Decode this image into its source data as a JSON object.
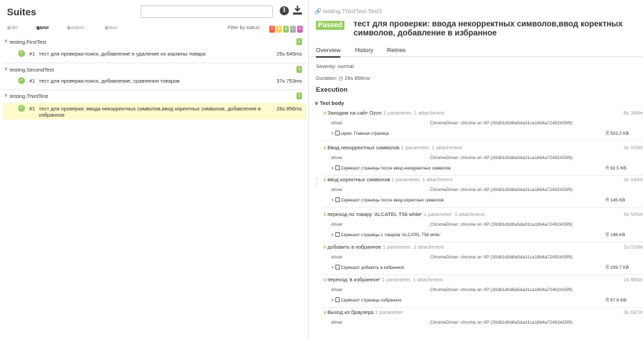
{
  "colors": {
    "passed": "#97cc64",
    "failed": "#fd5a3e",
    "broken": "#ffd050",
    "skipped": "#aaaaaa",
    "unknown": "#d35ebe",
    "selected_row": "#fdfacc"
  },
  "left": {
    "title": "Suites",
    "search_placeholder": "",
    "sort": {
      "order": "order",
      "name": "name",
      "duration": "duration",
      "status": "status"
    },
    "filter_label": "Filter by status:",
    "status_counts": [
      "0",
      "0",
      "3",
      "0",
      "0"
    ],
    "groups": [
      {
        "name": "testing.FirstTest",
        "count": "1",
        "tests": [
          {
            "num": "#1",
            "name": "тест для проверки:поиск, добавление и удаление из корзины товара",
            "duration": "25s 645ms"
          }
        ]
      },
      {
        "name": "testing.SecondTest",
        "count": "1",
        "tests": [
          {
            "num": "#1",
            "name": "тест для проверки:поиск, добавление, сравнения товаров",
            "duration": "37s 753ms"
          }
        ]
      },
      {
        "name": "testing.ThirdTest",
        "count": "1",
        "tests": [
          {
            "num": "#1",
            "name": "тест для проверки: ввода некорректных символов,ввод коректных символов, добавление в избранное",
            "duration": "26s 856ms"
          }
        ]
      }
    ]
  },
  "right": {
    "breadcrumb": "testing.ThirdTest.Test3",
    "status": "Passed",
    "title": "тест для проверки: ввода некорректных символов,ввод коректных символов, добавление в избранное",
    "tabs": [
      "Overview",
      "History",
      "Retries"
    ],
    "severity": "Severity: normal",
    "duration": "Duration: ◷ 26s 856ms",
    "execution": "Execution",
    "test_body": "Test body",
    "steps": [
      {
        "name": "Заходим на сайт Ozon",
        "extra": "1 parameter, 1 attachment",
        "time": "8s 368m",
        "param": "driver",
        "value": "ChromeDriver: chrome on XP (30d81d0d8a5da31ca18b4a72492435f9)",
        "attachment": "скрин: Главная страница",
        "size": "503.2 KB"
      },
      {
        "name": "Ввод некорректных символов",
        "extra": "1 parameter, 1 attachment",
        "time": "3s 109m",
        "param": "driver",
        "value": "ChromeDriver: chrome on XP (30d81d0d8a5da31ca18b4a72492435f9)",
        "attachment": "Скриншот страницы после ввод некорректных символов",
        "size": "92.5 KB"
      },
      {
        "name": "ввод коректных символов",
        "extra": "1 parameter, 1 attachment",
        "time": "3s 140m",
        "param": "driver",
        "value": "ChromeDriver: chrome on XP (30d81d0d8a5da31ca18b4a72492435f9)",
        "attachment": "Скриншот страницы после ввод коректных символов",
        "size": "145 KB"
      },
      {
        "name": "переход по товару 'ALCATEL T56 white'",
        "extra": "1 parameter, 1 attachment",
        "time": "3s 545m",
        "param": "driver",
        "value": "ChromeDriver: chrome on XP (30d81d0d8a5da31ca18b4a72492435f9)",
        "attachment": "Скриншот страницы с товаром 'ALCATEL T56 white'",
        "size": "196 KB"
      },
      {
        "name": "добавить в избранное",
        "extra": "1 parameter, 1 attachment",
        "time": "1s 016m",
        "param": "driver",
        "value": "ChromeDriver: chrome on XP (30d81d0d8a5da31ca18b4a72492435f9)",
        "attachment": "Скриншот добавить в избранное",
        "size": "209.7 KB"
      },
      {
        "name": "переход 'в избранное'",
        "extra": "1 parameter, 1 attachment",
        "time": "1s 883m",
        "param": "driver",
        "value": "ChromeDriver: chrome on XP (30d81d0d8a5da31ca18b4a72492435f9)",
        "attachment": "Скриншот страницы избранное",
        "size": "97.8 KB"
      },
      {
        "name": "Выход из браузера",
        "extra": "1 parameter",
        "time": "3s 687m",
        "param": "driver",
        "value": "ChromeDriver: chrome on XP (30d81d0d8a5da31ca18b4a72492435f9)",
        "attachment": null,
        "size": null
      }
    ]
  }
}
